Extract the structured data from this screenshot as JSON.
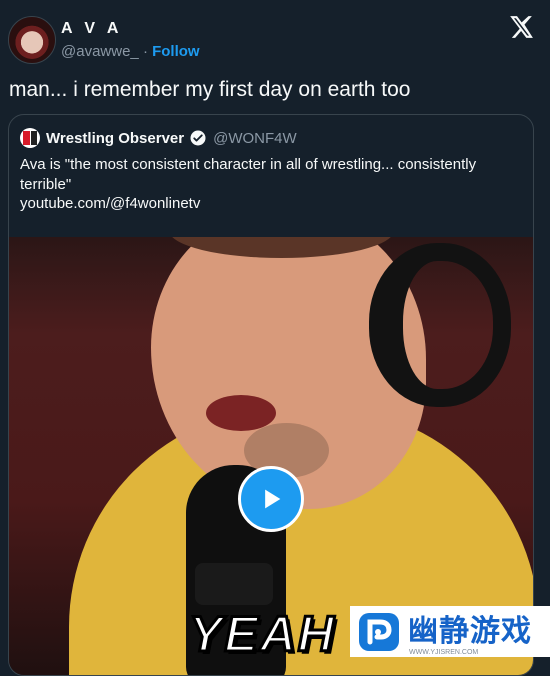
{
  "author": {
    "display_name": "A V A",
    "handle": "@avawwe_",
    "separator": "·",
    "follow_label": "Follow"
  },
  "tweet": {
    "text": "man... i remember my first day on earth too"
  },
  "quote": {
    "name": "Wrestling Observer",
    "handle": "@WONF4W",
    "text": "Ava is \"the most consistent character in all of wrestling... consistently terrible\"",
    "link": "youtube.com/@f4wonlinetv",
    "video": {
      "caption": "YEAH"
    }
  },
  "watermark": {
    "text": "幽静游戏",
    "url": "WWW.YJISREN.COM"
  },
  "colors": {
    "background": "#15202b",
    "accent": "#1d9bf0",
    "secondary_text": "#8b98a5",
    "border": "#38444d"
  },
  "icons": {
    "close": "x-logo-icon",
    "verified": "verified-badge-icon",
    "play": "play-icon"
  }
}
